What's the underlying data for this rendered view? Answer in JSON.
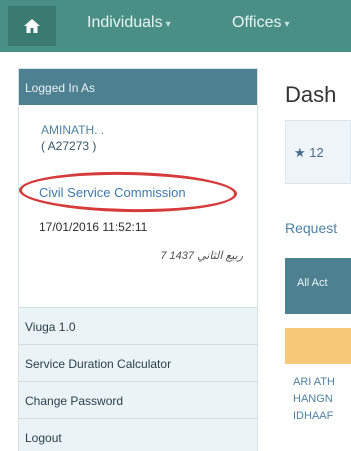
{
  "navbar": {
    "home_icon": "home-icon",
    "items": [
      {
        "label": "Individuals",
        "caret": "▾"
      },
      {
        "label": "Offices",
        "caret": "▾"
      }
    ],
    "color": "#4a8f86"
  },
  "panel": {
    "header": "Logged In As",
    "user_name": "AMINATH. .",
    "user_id": "( A27273   )",
    "organization": "Civil Service Commission",
    "datetime": "17/01/2016 11:52:11",
    "hijri_date": "7 ربيع الثاني 1437",
    "menu": [
      "Viuga 1.0",
      "Service Duration Calculator",
      "Change Password",
      "Logout"
    ]
  },
  "main": {
    "title": "Dash",
    "stat": {
      "icon": "star-icon",
      "value": "12"
    },
    "requests_label": "Request",
    "tab_label": "All Act",
    "rows": [
      "ARI ATH",
      "HANGN",
      "IDHAAF"
    ]
  },
  "colors": {
    "annotation": "#d63a3a",
    "header": "#4d8090",
    "link": "#3e78ad"
  }
}
